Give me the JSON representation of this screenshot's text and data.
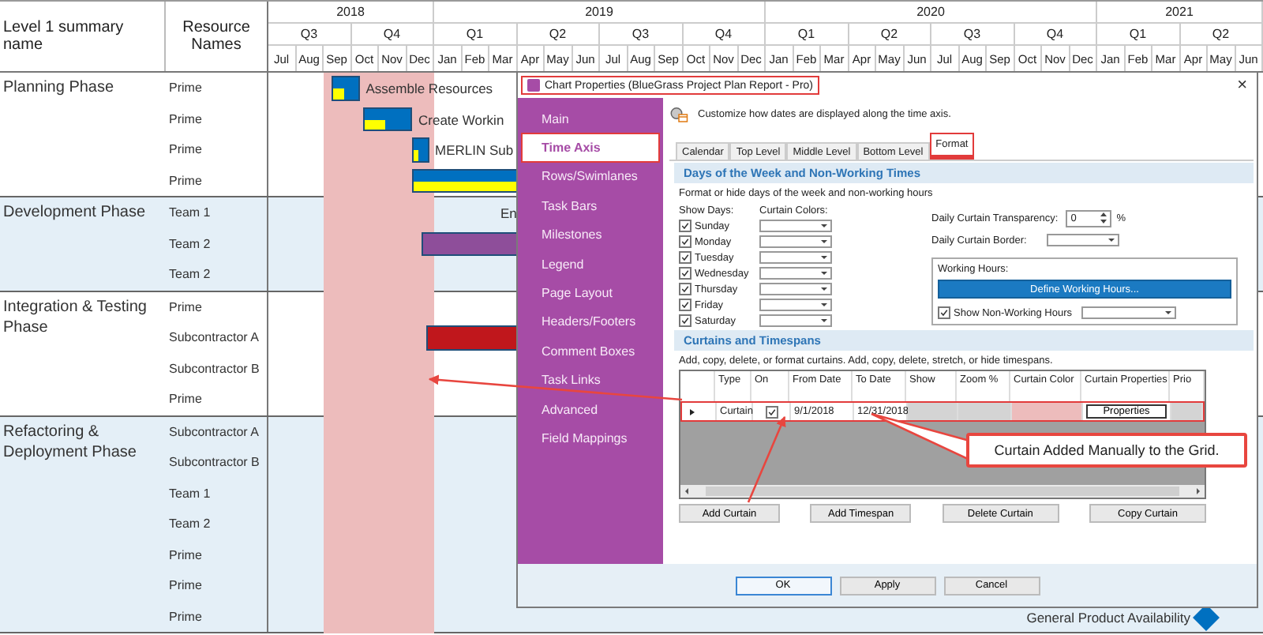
{
  "gantt": {
    "columns": [
      "Level 1 summary name",
      "Resource Names"
    ],
    "years": [
      {
        "label": "2018",
        "quarters": [
          {
            "label": "Q3",
            "months": [
              "Jul",
              "Aug",
              "Sep"
            ]
          },
          {
            "label": "Q4",
            "months": [
              "Oct",
              "Nov",
              "Dec"
            ]
          }
        ]
      },
      {
        "label": "2019",
        "quarters": [
          {
            "label": "Q1",
            "months": [
              "Jan",
              "Feb",
              "Mar"
            ]
          },
          {
            "label": "Q2",
            "months": [
              "Apr",
              "May",
              "Jun"
            ]
          },
          {
            "label": "Q3",
            "months": [
              "Jul",
              "Aug",
              "Sep"
            ]
          },
          {
            "label": "Q4",
            "months": [
              "Oct",
              "Nov",
              "Dec"
            ]
          }
        ]
      },
      {
        "label": "2020",
        "quarters": [
          {
            "label": "Q1",
            "months": [
              "Jan",
              "Feb",
              "Mar"
            ]
          },
          {
            "label": "Q2",
            "months": [
              "Apr",
              "May",
              "Jun"
            ]
          },
          {
            "label": "Q3",
            "months": [
              "Jul",
              "Aug",
              "Sep"
            ]
          },
          {
            "label": "Q4",
            "months": [
              "Oct",
              "Nov",
              "Dec"
            ]
          }
        ]
      },
      {
        "label": "2021",
        "quarters": [
          {
            "label": "Q1",
            "months": [
              "Jan",
              "Feb",
              "Mar"
            ]
          },
          {
            "label": "Q2",
            "months": [
              "Apr",
              "May",
              "Jun"
            ]
          }
        ]
      }
    ],
    "groups": [
      {
        "name": "Planning Phase",
        "rows": [
          {
            "resource": "Prime",
            "tasks": [
              {
                "kind": "bar",
                "label": "Assemble Resources",
                "level": 0.45,
                "color": "#0070c0"
              }
            ]
          },
          {
            "resource": "Prime",
            "tasks": [
              {
                "kind": "bar",
                "label": "Create Workin",
                "level": 0.45,
                "color": "#0070c0"
              }
            ]
          },
          {
            "resource": "Prime",
            "tasks": [
              {
                "kind": "bar",
                "label": "MERLIN Sub",
                "level": 0.35,
                "color": "#0070c0"
              }
            ]
          },
          {
            "resource": "Prime",
            "tasks": [
              {
                "kind": "bar",
                "level": 1,
                "color": "#0070c0"
              }
            ]
          }
        ]
      },
      {
        "name": "Development Phase",
        "rows": [
          {
            "resource": "Team 1",
            "tasks": [
              {
                "kind": "label",
                "label": "En"
              }
            ]
          },
          {
            "resource": "Team 2",
            "tasks": [
              {
                "kind": "bar",
                "color": "#8e4e9a"
              }
            ]
          },
          {
            "resource": "Team 2",
            "tasks": []
          }
        ]
      },
      {
        "name": "Integration & Testing Phase",
        "rows": [
          {
            "resource": "Prime",
            "tasks": []
          },
          {
            "resource": "Subcontractor A",
            "tasks": [
              {
                "kind": "bar",
                "color": "#c0171c"
              }
            ]
          },
          {
            "resource": "Subcontractor B",
            "tasks": []
          },
          {
            "resource": "Prime",
            "tasks": []
          }
        ]
      },
      {
        "name": "Refactoring & Deployment Phase",
        "rows": [
          {
            "resource": "Subcontractor A",
            "tasks": []
          },
          {
            "resource": "Subcontractor B",
            "tasks": []
          },
          {
            "resource": "Team 1",
            "tasks": []
          },
          {
            "resource": "Team 2",
            "tasks": []
          },
          {
            "resource": "Prime",
            "tasks": []
          },
          {
            "resource": "Prime",
            "tasks": []
          },
          {
            "resource": "Prime",
            "tasks": [
              {
                "kind": "milestone",
                "label": "General Product Availability",
                "color": "#0070c0"
              }
            ]
          }
        ]
      }
    ]
  },
  "dialog": {
    "title": "Chart Properties (BlueGrass Project Plan Report - Pro)",
    "title_highlighted": true,
    "close": "×",
    "nav": [
      {
        "label": "Main",
        "selected": false,
        "highlighted": false
      },
      {
        "label": "Time Axis",
        "selected": true,
        "highlighted": true
      },
      {
        "label": "Rows/Swimlanes",
        "selected": false,
        "highlighted": false
      },
      {
        "label": "Task Bars",
        "selected": false,
        "highlighted": false
      },
      {
        "label": "Milestones",
        "selected": false,
        "highlighted": false
      },
      {
        "label": "Legend",
        "selected": false,
        "highlighted": false
      },
      {
        "label": "Page Layout",
        "selected": false,
        "highlighted": false
      },
      {
        "label": "Headers/Footers",
        "selected": false,
        "highlighted": false
      },
      {
        "label": "Comment Boxes",
        "selected": false,
        "highlighted": false
      },
      {
        "label": "Task Links",
        "selected": false,
        "highlighted": false
      },
      {
        "label": "Advanced",
        "selected": false,
        "highlighted": false
      },
      {
        "label": "Field Mappings",
        "selected": false,
        "highlighted": false
      }
    ],
    "description": "Customize how dates are displayed along the time axis.",
    "tabs": [
      {
        "label": "Calendar",
        "selected": false,
        "highlighted": false
      },
      {
        "label": "Top Level",
        "selected": false,
        "highlighted": false
      },
      {
        "label": "Middle Level",
        "selected": false,
        "highlighted": false
      },
      {
        "label": "Bottom Level",
        "selected": false,
        "highlighted": false
      },
      {
        "label": "Format",
        "selected": true,
        "highlighted": true
      }
    ],
    "days_section": {
      "heading": "Days of the Week and Non-Working Times",
      "hint": "Format or hide days of the week and non-working hours",
      "show_days_label": "Show Days:",
      "curtain_colors_label": "Curtain Colors:",
      "days": [
        {
          "label": "Sunday",
          "checked": true
        },
        {
          "label": "Monday",
          "checked": true
        },
        {
          "label": "Tuesday",
          "checked": true
        },
        {
          "label": "Wednesday",
          "checked": true
        },
        {
          "label": "Thursday",
          "checked": true
        },
        {
          "label": "Friday",
          "checked": true
        },
        {
          "label": "Saturday",
          "checked": true
        }
      ],
      "transparency": {
        "label": "Daily Curtain Transparency:",
        "value": "0",
        "unit": "%"
      },
      "border": {
        "label": "Daily Curtain Border:"
      },
      "working_hours": {
        "label": "Working Hours:",
        "button": "Define Working Hours...",
        "show_non_working": {
          "label": "Show Non-Working Hours",
          "checked": true
        }
      }
    },
    "curtains_section": {
      "heading": "Curtains and Timespans",
      "hint": "Add, copy, delete, or format curtains.  Add, copy, delete, stretch, or hide timespans.",
      "columns": [
        "Type",
        "On",
        "From Date",
        "To Date",
        "Show",
        "Zoom %",
        "Curtain Color",
        "Curtain Properties",
        "Prio"
      ],
      "rows": [
        {
          "type": "Curtain",
          "on": true,
          "from": "9/1/2018",
          "to": "12/31/2018",
          "color": "#edbcbc",
          "properties_button": "Properties",
          "highlighted": true
        }
      ],
      "buttons": [
        "Add Curtain",
        "Add Timespan",
        "Delete Curtain",
        "Copy Curtain"
      ]
    },
    "buttons": [
      {
        "label": "OK",
        "default": true
      },
      {
        "label": "Apply",
        "default": false
      },
      {
        "label": "Cancel",
        "default": false
      }
    ]
  },
  "callout": {
    "text": "Curtain Added Manually to the Grid."
  }
}
